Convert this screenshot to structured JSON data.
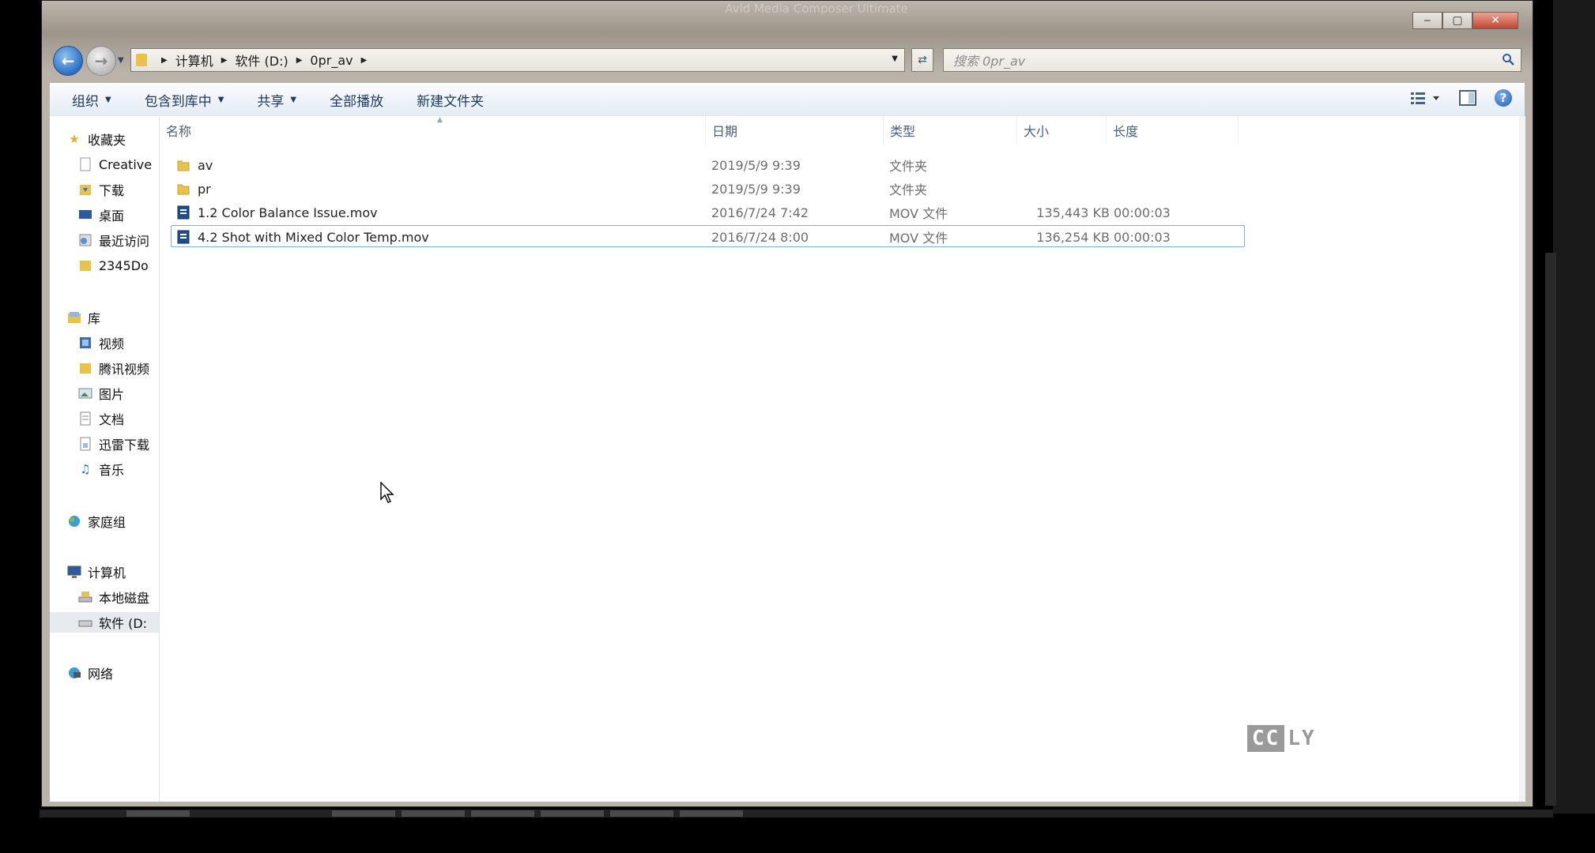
{
  "window": {
    "title": "Avid Media Composer Ultimate",
    "controls": {
      "minimize": "‒",
      "maximize": "▢",
      "close": "✕"
    }
  },
  "address_bar": {
    "path": [
      "计算机",
      "软件 (D:)",
      "0pr_av"
    ]
  },
  "search": {
    "placeholder": "搜索 0pr_av"
  },
  "toolbar": {
    "items": [
      {
        "label": "组织",
        "dropdown": true
      },
      {
        "label": "包含到库中",
        "dropdown": true
      },
      {
        "label": "共享",
        "dropdown": true
      },
      {
        "label": "全部播放",
        "dropdown": false
      },
      {
        "label": "新建文件夹",
        "dropdown": false
      }
    ],
    "right_icons": [
      "view-icon",
      "preview-pane-icon",
      "help-icon"
    ]
  },
  "navigation": {
    "favorites": {
      "label": "收藏夹",
      "items": [
        "Creative",
        "下载",
        "桌面",
        "最近访问",
        "2345Do"
      ]
    },
    "libraries": {
      "label": "库",
      "items": [
        "视频",
        "腾讯视频",
        "图片",
        "文档",
        "迅雷下载",
        "音乐"
      ]
    },
    "homegroup": {
      "label": "家庭组"
    },
    "computer": {
      "label": "计算机",
      "items": [
        "本地磁盘",
        "软件 (D:"
      ]
    },
    "network": {
      "label": "网络"
    }
  },
  "columns": [
    "名称",
    "日期",
    "类型",
    "大小",
    "长度"
  ],
  "files": [
    {
      "name": "av",
      "date": "2019/5/9 9:39",
      "type": "文件夹",
      "size": "",
      "length": "",
      "kind": "folder"
    },
    {
      "name": "pr",
      "date": "2019/5/9 9:39",
      "type": "文件夹",
      "size": "",
      "length": "",
      "kind": "folder"
    },
    {
      "name": "1.2 Color Balance Issue.mov",
      "date": "2016/7/24 7:42",
      "type": "MOV 文件",
      "size": "135,443 KB",
      "length": "00:00:03",
      "kind": "video"
    },
    {
      "name": "4.2 Shot with Mixed Color Temp.mov",
      "date": "2016/7/24 8:00",
      "type": "MOV 文件",
      "size": "136,254 KB",
      "length": "00:00:03",
      "kind": "video"
    }
  ],
  "focused_row": 3,
  "watermark": {
    "box": "CC",
    "text": "LY"
  },
  "colors": {
    "toolbar_text": "#1e395b",
    "folder": "#e8c24a",
    "selection_border": "#84acdd"
  }
}
